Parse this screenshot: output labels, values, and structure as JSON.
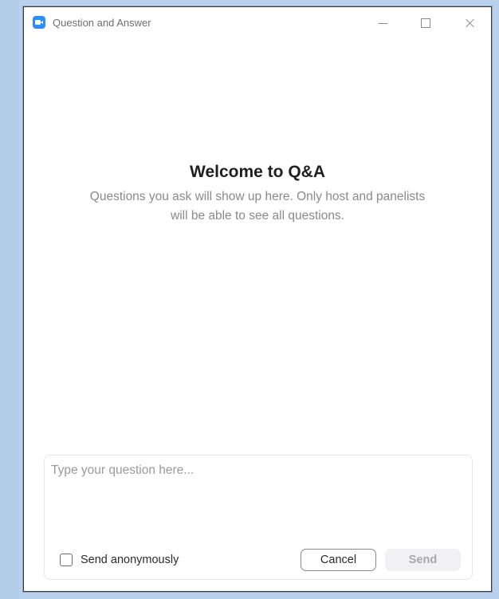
{
  "window": {
    "title": "Question and Answer"
  },
  "welcome": {
    "title": "Welcome to Q&A",
    "description": "Questions you ask will show up here. Only host and panelists will be able to see all questions."
  },
  "composer": {
    "placeholder": "Type your question here...",
    "value": "",
    "anonymous_label": "Send anonymously",
    "anonymous_checked": false,
    "cancel_label": "Cancel",
    "send_label": "Send"
  },
  "icons": {
    "app": "zoom-app-icon",
    "minimize": "minimize-icon",
    "maximize": "maximize-icon",
    "close": "close-icon"
  },
  "colors": {
    "brand": "#2d8cff",
    "send_disabled_bg": "#f1f1f3",
    "send_disabled_text": "#a8a8a8"
  }
}
